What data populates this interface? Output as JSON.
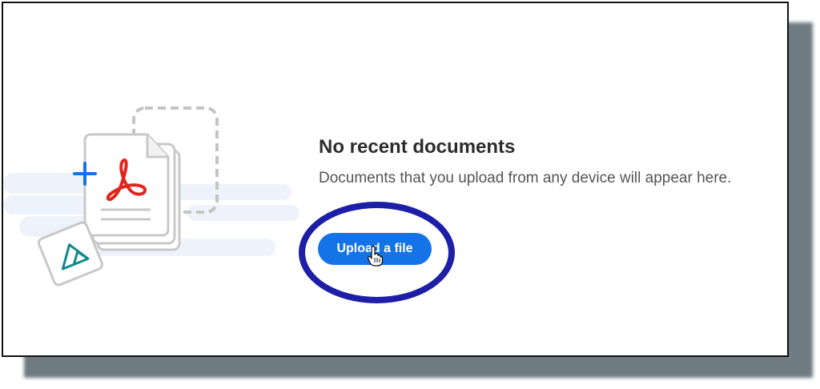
{
  "empty_state": {
    "title": "No recent documents",
    "description": "Documents that you upload from any device will appear here.",
    "upload_button_label": "Upload a file"
  },
  "colors": {
    "accent_blue": "#1473e6",
    "highlight_ring": "#1d1fa6",
    "pdf_red": "#e2261d",
    "plus_blue": "#1473e6",
    "image_teal": "#0f8a8a"
  },
  "icons": {
    "illustration": "document-stack-illustration",
    "plus": "plus-icon",
    "pdf": "acrobat-pdf-icon",
    "image": "image-file-icon",
    "cursor": "hand-pointer-cursor-icon"
  }
}
